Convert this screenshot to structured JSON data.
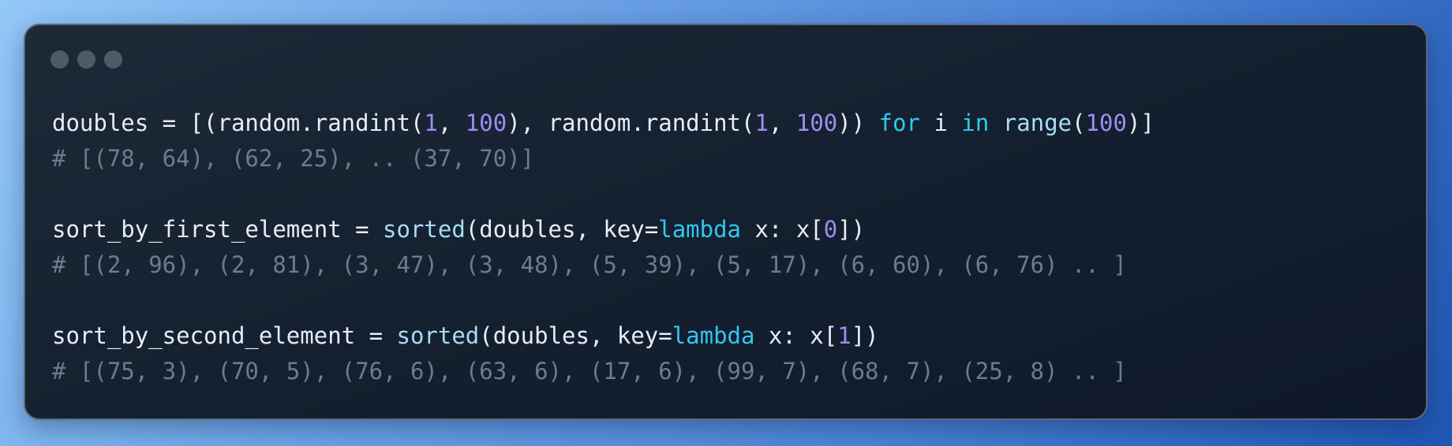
{
  "window": {
    "controls": [
      "dot",
      "dot",
      "dot"
    ]
  },
  "code": {
    "lines": [
      [
        {
          "text": "doubles = [(random.randint(",
          "type": "plain"
        },
        {
          "text": "1",
          "type": "num"
        },
        {
          "text": ", ",
          "type": "plain"
        },
        {
          "text": "100",
          "type": "num"
        },
        {
          "text": "), random.randint(",
          "type": "plain"
        },
        {
          "text": "1",
          "type": "num"
        },
        {
          "text": ", ",
          "type": "plain"
        },
        {
          "text": "100",
          "type": "num"
        },
        {
          "text": ")) ",
          "type": "plain"
        },
        {
          "text": "for",
          "type": "kw"
        },
        {
          "text": " i ",
          "type": "plain"
        },
        {
          "text": "in",
          "type": "kw"
        },
        {
          "text": " ",
          "type": "plain"
        },
        {
          "text": "range",
          "type": "builtin"
        },
        {
          "text": "(",
          "type": "plain"
        },
        {
          "text": "100",
          "type": "num"
        },
        {
          "text": ")]",
          "type": "plain"
        }
      ],
      [
        {
          "text": "# [(78, 64), (62, 25), .. (37, 70)]",
          "type": "comment"
        }
      ],
      [],
      [
        {
          "text": "sort_by_first_element = ",
          "type": "plain"
        },
        {
          "text": "sorted",
          "type": "builtin"
        },
        {
          "text": "(doubles, key=",
          "type": "plain"
        },
        {
          "text": "lambda",
          "type": "kw"
        },
        {
          "text": " x: x[",
          "type": "plain"
        },
        {
          "text": "0",
          "type": "num"
        },
        {
          "text": "])",
          "type": "plain"
        }
      ],
      [
        {
          "text": "# [(2, 96), (2, 81), (3, 47), (3, 48), (5, 39), (5, 17), (6, 60), (6, 76) .. ]",
          "type": "comment"
        }
      ],
      [],
      [
        {
          "text": "sort_by_second_element = ",
          "type": "plain"
        },
        {
          "text": "sorted",
          "type": "builtin"
        },
        {
          "text": "(doubles, key=",
          "type": "plain"
        },
        {
          "text": "lambda",
          "type": "kw"
        },
        {
          "text": " x: x[",
          "type": "plain"
        },
        {
          "text": "1",
          "type": "num"
        },
        {
          "text": "])",
          "type": "plain"
        }
      ],
      [
        {
          "text": "# [(75, 3), (70, 5), (76, 6), (63, 6), (17, 6), (99, 7), (68, 7), (25, 8) .. ]",
          "type": "comment"
        }
      ]
    ]
  },
  "colors": {
    "background_start": "#93c8f7",
    "background_end": "#1f56b3",
    "window": "#14202f",
    "plain": "#e7edf6",
    "number": "#9f8cf2",
    "keyword": "#32c7ef",
    "builtin": "#a6dcf5",
    "comment": "#6e7b8b"
  }
}
